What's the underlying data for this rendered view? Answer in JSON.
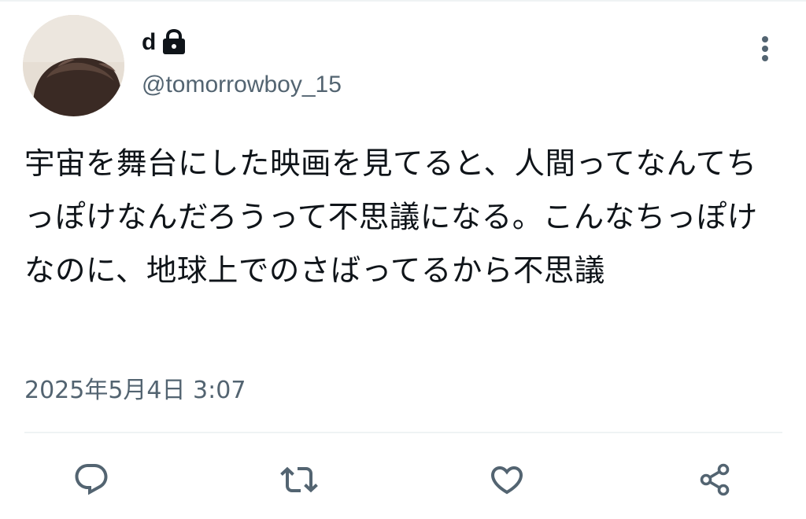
{
  "tweet": {
    "author": {
      "display_name": "d",
      "handle": "@tomorrowboy_15",
      "protected": true
    },
    "text": "宇宙を舞台にした映画を見てると、人間ってなんてちっぽけなんだろうって不思議になる。こんなちっぽけなのに、地球上でのさばってるから不思議",
    "timestamp": "2025年5月4日 3:07"
  },
  "icons": {
    "lock": "lock-icon",
    "more": "more-vertical-icon",
    "reply": "reply-icon",
    "retweet": "retweet-icon",
    "like": "heart-icon",
    "share": "share-icon"
  },
  "colors": {
    "text_primary": "#0f1419",
    "text_secondary": "#536471",
    "divider": "#eff3f4",
    "icon": "#536471"
  }
}
